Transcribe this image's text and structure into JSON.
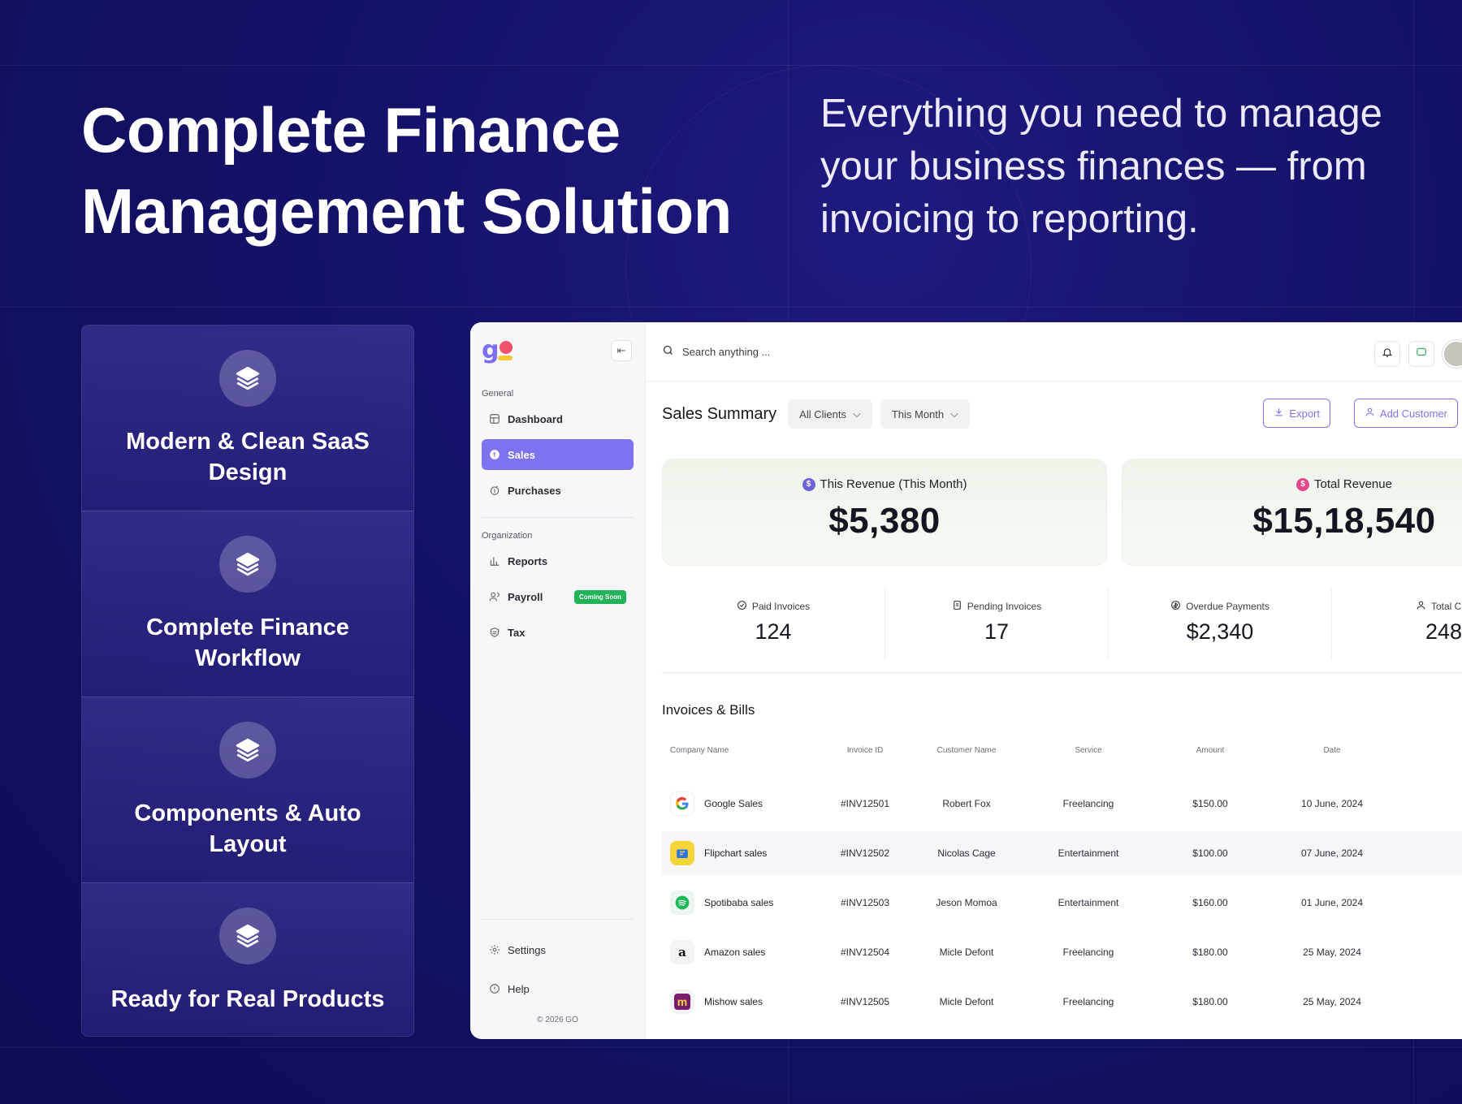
{
  "hero": {
    "title_line1": "Complete Finance",
    "title_line2": "Management Solution",
    "subtitle": "Everything you need to manage your business finances — from invoicing to reporting."
  },
  "features": [
    {
      "label": "Modern & Clean SaaS Design",
      "icon": "layers-icon"
    },
    {
      "label": "Complete Finance Workflow",
      "icon": "layers-icon"
    },
    {
      "label": "Components & Auto Layout",
      "icon": "layers-icon"
    },
    {
      "label": "Ready for Real Products",
      "icon": "layers-icon"
    }
  ],
  "sidebar": {
    "logo": "g",
    "section_general": "General",
    "section_org": "Organization",
    "items": {
      "dashboard": "Dashboard",
      "sales": "Sales",
      "purchases": "Purchases",
      "reports": "Reports",
      "payroll": "Payroll",
      "tax": "Tax",
      "settings": "Settings",
      "help": "Help"
    },
    "coming_soon": "Coming Soon",
    "copyright": "© 2026 GO"
  },
  "topbar": {
    "search_placeholder": "Search anything ..."
  },
  "summary": {
    "title": "Sales Summary",
    "filter_clients": "All Clients",
    "filter_period": "This Month",
    "export": "Export",
    "add_customer": "Add Customer"
  },
  "revenue": {
    "this_month_label": "This Revenue (This Month)",
    "this_month_value": "$5,380",
    "total_label": "Total Revenue",
    "total_value": "$15,18,540"
  },
  "stats": [
    {
      "label": "Paid Invoices",
      "value": "124"
    },
    {
      "label": "Pending Invoices",
      "value": "17"
    },
    {
      "label": "Overdue Payments",
      "value": "$2,340"
    },
    {
      "label": "Total Cus",
      "value": "248"
    }
  ],
  "invoices": {
    "title": "Invoices & Bills",
    "columns": [
      "Company Name",
      "Invoice ID",
      "Customer Name",
      "Service",
      "Amount",
      "Date"
    ],
    "rows": [
      {
        "company": "Google Sales",
        "id": "#INV12501",
        "customer": "Robert Fox",
        "service": "Freelancing",
        "amount": "$150.00",
        "date": "10 June, 2024"
      },
      {
        "company": "Flipchart sales",
        "id": "#INV12502",
        "customer": "Nicolas Cage",
        "service": "Entertainment",
        "amount": "$100.00",
        "date": "07 June, 2024"
      },
      {
        "company": "Spotibaba sales",
        "id": "#INV12503",
        "customer": "Jeson Momoa",
        "service": "Entertainment",
        "amount": "$160.00",
        "date": "01 June, 2024"
      },
      {
        "company": "Amazon sales",
        "id": "#INV12504",
        "customer": "Micle Defont",
        "service": "Freelancing",
        "amount": "$180.00",
        "date": "25 May, 2024"
      },
      {
        "company": "Mishow sales",
        "id": "#INV12505",
        "customer": "Micle Defont",
        "service": "Freelancing",
        "amount": "$180.00",
        "date": "25 May, 2024"
      }
    ]
  },
  "colors": {
    "background": "#15126a",
    "accent": "#7d72ef",
    "success": "#22b35a"
  }
}
